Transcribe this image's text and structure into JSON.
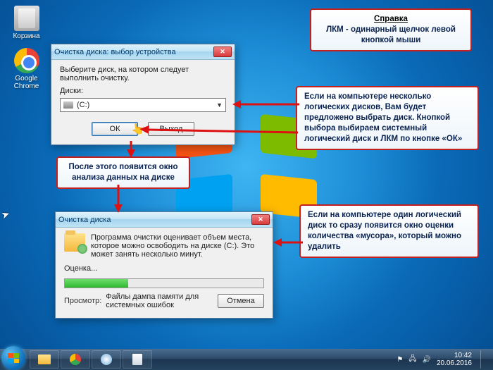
{
  "desktop": {
    "icons": {
      "trash": "Корзина",
      "chrome": "Google Chrome"
    }
  },
  "dlg1": {
    "title": "Очистка диска: выбор устройства",
    "instr": "Выберите диск, на котором следует выполнить очистку.",
    "disks_label": "Диски:",
    "selected": "(C:)",
    "ok": "ОК",
    "exit": "Выход"
  },
  "dlg2": {
    "title": "Очистка диска",
    "text": "Программа очистки оценивает объем места, которое можно освободить на диске (C:). Это может занять несколько минут.",
    "score_label": "Оценка...",
    "view_label": "Просмотр:",
    "view_value": "Файлы дампа памяти для системных ошибок",
    "cancel": "Отмена"
  },
  "callouts": {
    "c1_head": "Справка",
    "c1_body": "ЛКМ - одинарный щелчок левой кнопкой мыши",
    "c2": "Если на компьютере несколько логических дисков, Вам будет предложено выбрать диск. Кнопкой выбора выбираем системный логический диск и ЛКМ по кнопке «ОК»",
    "c3": "После этого появится окно анализа данных на диске",
    "c4": "Если на компьютере один логический диск то сразу появится окно оценки количества «мусора», который можно удалить"
  },
  "taskbar": {
    "time": "10:42",
    "date": "20.06.2016"
  }
}
